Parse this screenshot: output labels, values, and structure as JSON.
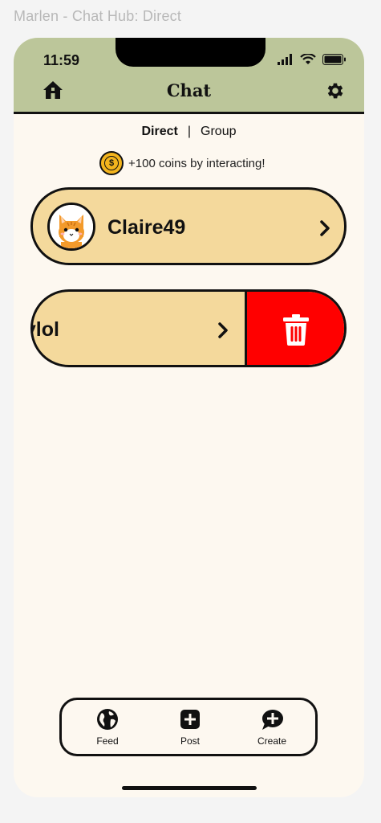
{
  "window_title": "Marlen - Chat Hub: Direct",
  "status_bar": {
    "time": "11:59"
  },
  "header": {
    "title": "Chat"
  },
  "tabs": {
    "direct": "Direct",
    "separator": "|",
    "group": "Group",
    "active": "Direct"
  },
  "coins": {
    "symbol": "$",
    "text": "+100 coins by interacting!"
  },
  "chats": [
    {
      "name": "Claire49"
    },
    {
      "name": "cylol"
    }
  ],
  "bottom_nav": {
    "feed": "Feed",
    "post": "Post",
    "create": "Create"
  },
  "colors": {
    "header_bg": "#bcc69a",
    "page_bg": "#fdf8f0",
    "card_bg": "#f4d99c",
    "delete_bg": "#ff0000",
    "coin": "#f3b41d"
  },
  "icons": [
    "home-icon",
    "gear-icon",
    "coin-icon",
    "chevron-right-icon",
    "trash-icon",
    "globe-icon",
    "plus-square-icon",
    "chat-plus-icon"
  ]
}
